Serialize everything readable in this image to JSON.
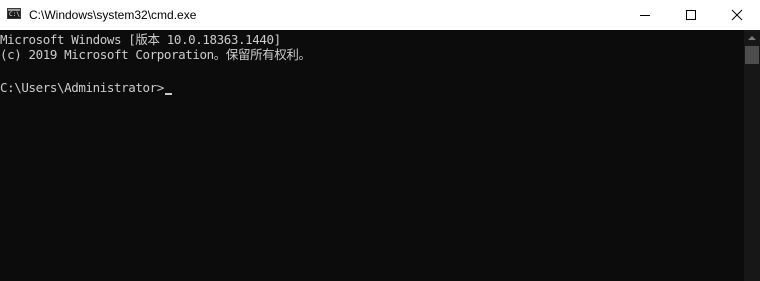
{
  "window": {
    "title": "C:\\Windows\\system32\\cmd.exe",
    "icon": "command-prompt-icon"
  },
  "controls": {
    "minimize_icon": "minimize-icon",
    "maximize_icon": "maximize-icon",
    "close_icon": "close-icon"
  },
  "console": {
    "lines": [
      "Microsoft Windows [版本 10.0.18363.1440]",
      "(c) 2019 Microsoft Corporation。保留所有权利。",
      "",
      "C:\\Users\\Administrator>"
    ],
    "foreground_color": "#cccccc",
    "background_color": "#0c0c0c"
  },
  "scrollbar": {
    "up_arrow_icon": "scroll-up-arrow-icon"
  }
}
